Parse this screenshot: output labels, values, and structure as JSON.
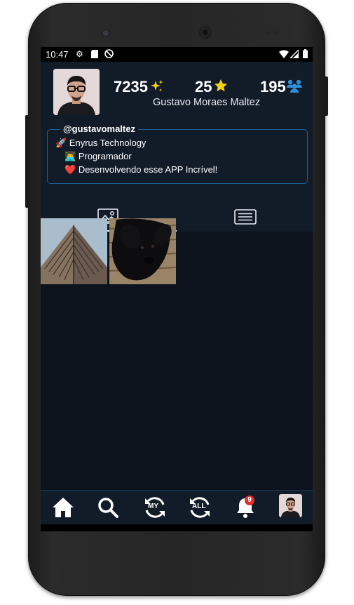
{
  "status": {
    "time": "10:47"
  },
  "profile": {
    "sparkles_count": "7235",
    "stars_count": "25",
    "followers_count": "195",
    "full_name": "Gustavo Moraes Maltez",
    "username": "@gustavomaltez",
    "bio": [
      {
        "emoji": "🚀",
        "text": "Enyrus Technology"
      },
      {
        "emoji": "👨‍💻",
        "text": "Programador"
      },
      {
        "emoji": "❤️",
        "text": "Desenvolvendo esse APP Incrível!"
      }
    ]
  },
  "tabs": [
    {
      "icon": "image-icon"
    },
    {
      "icon": "list-icon"
    }
  ],
  "grid": [
    {
      "subject": "building-photo"
    },
    {
      "subject": "black-dog-photo"
    }
  ],
  "nav": {
    "my_label": "MY",
    "all_label": "ALL",
    "notification_badge": "9"
  },
  "colors": {
    "background": "#0c131d",
    "surface": "#121b28",
    "accent_border": "#1e5f95",
    "badge": "#e0302d",
    "star": "#f5d313",
    "followers_icon": "#2f8fd8"
  }
}
